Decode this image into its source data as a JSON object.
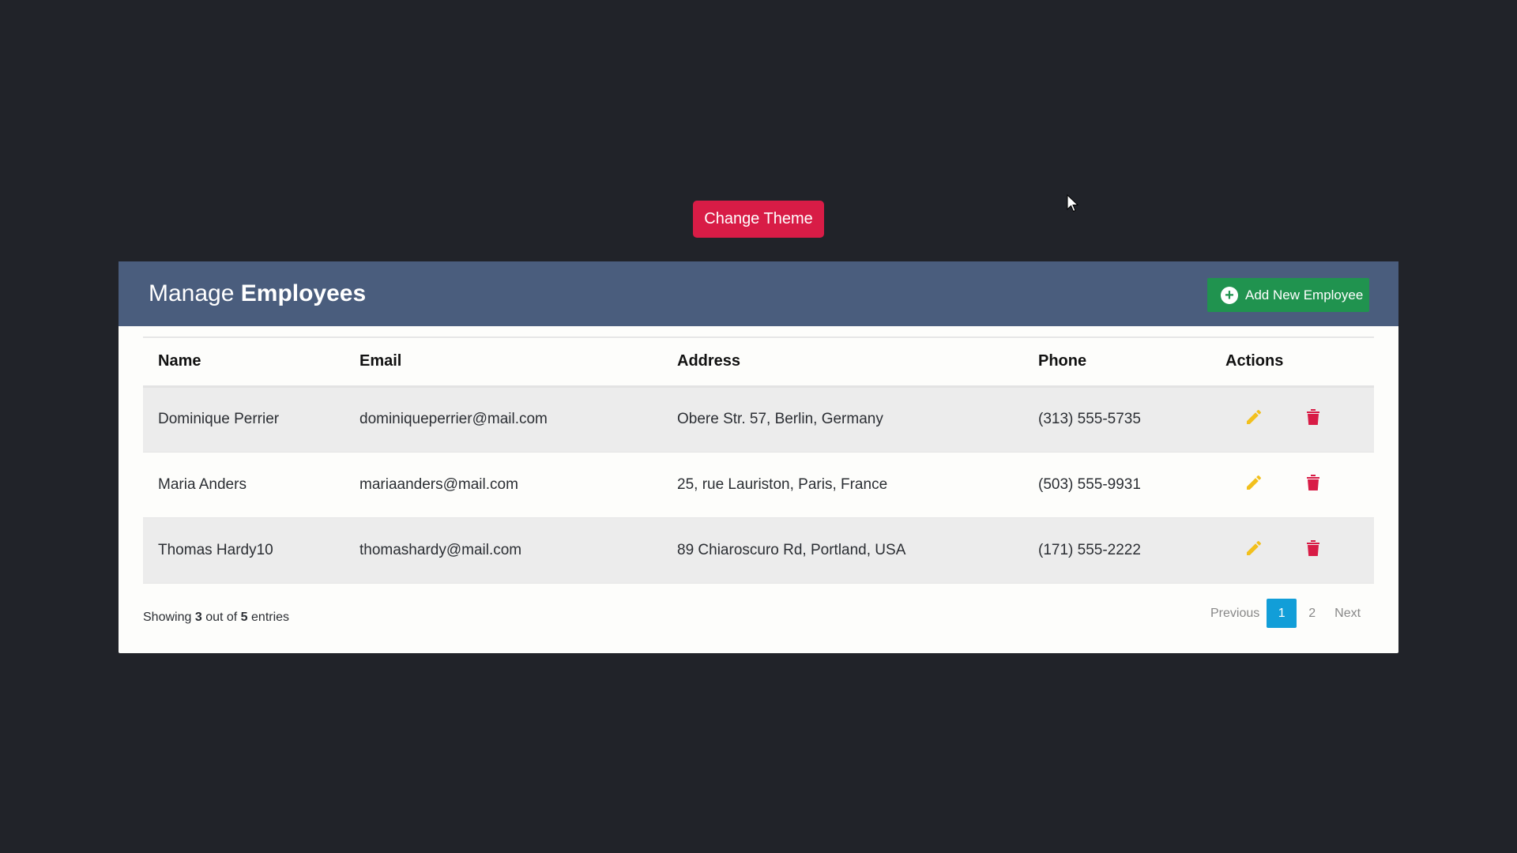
{
  "theme_button": {
    "label": "Change Theme",
    "color": "#d81c46"
  },
  "panel": {
    "title_normal": "Manage",
    "title_bold": "Employees",
    "header_color": "#4a5d7d",
    "add_button": {
      "label": "Add New Employee",
      "icon": "plus-circle-icon",
      "color": "#20934f"
    }
  },
  "table": {
    "columns": [
      "Name",
      "Email",
      "Address",
      "Phone",
      "Actions"
    ],
    "rows": [
      {
        "name": "Dominique Perrier",
        "email": "dominiqueperrier@mail.com",
        "address": "Obere Str. 57, Berlin, Germany",
        "phone": "(313) 555-5735"
      },
      {
        "name": "Maria Anders",
        "email": "mariaanders@mail.com",
        "address": "25, rue Lauriston, Paris, France",
        "phone": "(503) 555-9931"
      },
      {
        "name": "Thomas Hardy10",
        "email": "thomashardy@mail.com",
        "address": "89 Chiaroscuro Rd, Portland, USA",
        "phone": "(171) 555-2222"
      }
    ],
    "action_icons": {
      "edit": "pencil-icon",
      "delete": "trash-icon",
      "edit_color": "#f2c01d",
      "delete_color": "#d81c46"
    }
  },
  "footer": {
    "showing_prefix": "Showing",
    "shown_count": "3",
    "middle": "out of",
    "total_count": "5",
    "suffix": "entries"
  },
  "pagination": {
    "previous": "Previous",
    "pages": [
      "1",
      "2"
    ],
    "active_page": "1",
    "next": "Next",
    "active_color": "#129ed8"
  }
}
